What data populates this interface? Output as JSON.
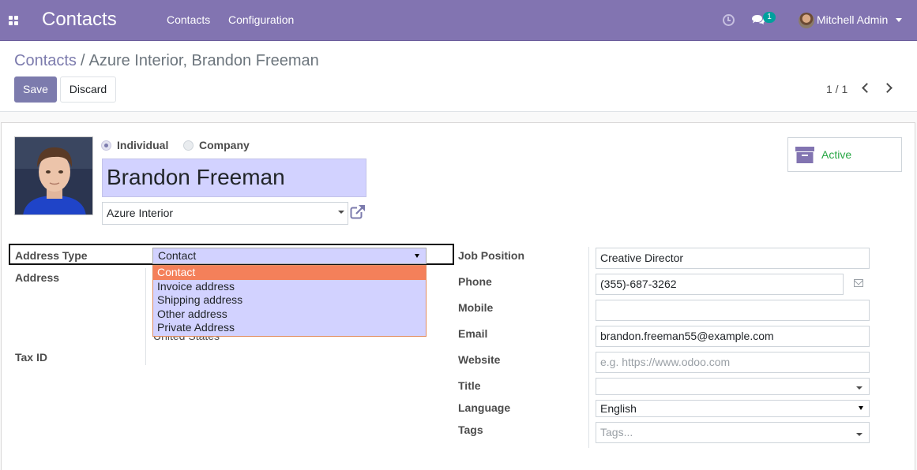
{
  "navbar": {
    "app_title": "Contacts",
    "menu": [
      "Contacts",
      "Configuration"
    ],
    "chat_badge": "1",
    "user_name": "Mitchell Admin"
  },
  "breadcrumb": {
    "parent": "Contacts",
    "separator": "/",
    "current": "Azure Interior, Brandon Freeman"
  },
  "buttons": {
    "save": "Save",
    "discard": "Discard"
  },
  "pager": {
    "value": "1 / 1"
  },
  "form": {
    "company_type": {
      "options": [
        "Individual",
        "Company"
      ],
      "selected": "Individual"
    },
    "name": "Brandon Freeman",
    "parent_company": "Azure Interior",
    "active_button": "Active",
    "left": {
      "address_type_label": "Address Type",
      "address_type_value": "Contact",
      "address_type_options": [
        "Contact",
        "Invoice address",
        "Shipping address",
        "Other address",
        "Private Address"
      ],
      "address_label": "Address",
      "country": "United States",
      "tax_id_label": "Tax ID"
    },
    "right": {
      "job_position_label": "Job Position",
      "job_position": "Creative Director",
      "phone_label": "Phone",
      "phone": "(355)-687-3262",
      "mobile_label": "Mobile",
      "mobile": "",
      "email_label": "Email",
      "email": "brandon.freeman55@example.com",
      "website_label": "Website",
      "website_placeholder": "e.g. https://www.odoo.com",
      "title_label": "Title",
      "title": "",
      "language_label": "Language",
      "language": "English",
      "tags_label": "Tags",
      "tags_placeholder": "Tags..."
    }
  },
  "colors": {
    "navbar": "#8274b1",
    "primary": "#7c7bad",
    "required_field": "#d2d2ff",
    "dropdown_highlight": "#f4805a",
    "active_green": "#28a745"
  }
}
